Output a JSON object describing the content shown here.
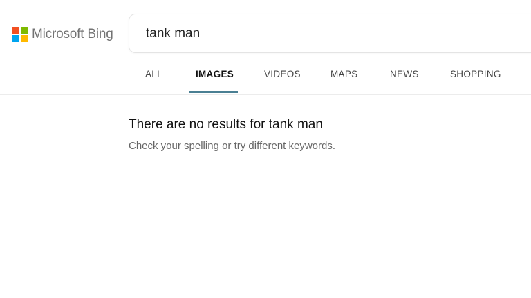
{
  "brand": {
    "name": "Microsoft Bing",
    "logo_colors": [
      "#f25022",
      "#7fba00",
      "#00a4ef",
      "#ffb900"
    ]
  },
  "search": {
    "query": "tank man"
  },
  "tabs": [
    {
      "label": "ALL",
      "active": false
    },
    {
      "label": "IMAGES",
      "active": true
    },
    {
      "label": "VIDEOS",
      "active": false
    },
    {
      "label": "MAPS",
      "active": false
    },
    {
      "label": "NEWS",
      "active": false
    },
    {
      "label": "SHOPPING",
      "active": false
    }
  ],
  "accent_color": "#4a7f93",
  "results": {
    "message": "There are no results for tank man",
    "hint": "Check your spelling or try different keywords."
  }
}
